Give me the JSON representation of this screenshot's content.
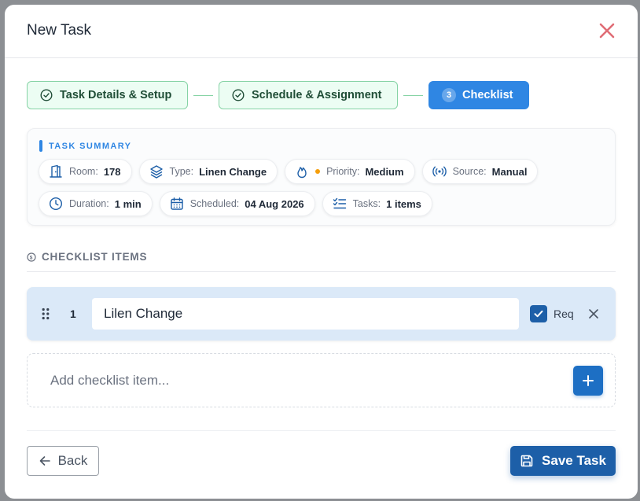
{
  "dialog": {
    "title": "New Task"
  },
  "stepper": {
    "steps": [
      {
        "label": "Task Details & Setup",
        "state": "done"
      },
      {
        "label": "Schedule & Assignment",
        "state": "done"
      },
      {
        "number": "3",
        "label": "Checklist",
        "state": "active"
      }
    ]
  },
  "summary": {
    "heading": "TASK SUMMARY",
    "room": {
      "label": "Room:",
      "value": "178",
      "icon": "door-icon"
    },
    "type": {
      "label": "Type:",
      "value": "Linen Change",
      "icon": "layers-icon"
    },
    "priority": {
      "label": "Priority:",
      "value": "Medium",
      "icon": "flame-icon",
      "dot_color": "#f59e0b"
    },
    "source": {
      "label": "Source:",
      "value": "Manual",
      "icon": "broadcast-icon"
    },
    "duration": {
      "label": "Duration:",
      "value": "1 min",
      "icon": "clock-icon"
    },
    "scheduled": {
      "label": "Scheduled:",
      "value": "04 Aug 2026",
      "icon": "calendar-icon"
    },
    "tasks": {
      "label": "Tasks:",
      "value": "1 items",
      "icon": "checklist-icon"
    }
  },
  "checklist": {
    "title": "CHECKLIST ITEMS",
    "items": [
      {
        "number": "1",
        "text": "Lilen Change",
        "required": true,
        "req_label": "Req"
      }
    ],
    "add_placeholder": "Add checklist item..."
  },
  "footer": {
    "back_label": "Back",
    "save_label": "Save Task"
  },
  "colors": {
    "primary": "#1d5fa8",
    "active_step": "#2f86e3",
    "done_step_bg": "#ecfdf3",
    "close": "#e06c75"
  }
}
